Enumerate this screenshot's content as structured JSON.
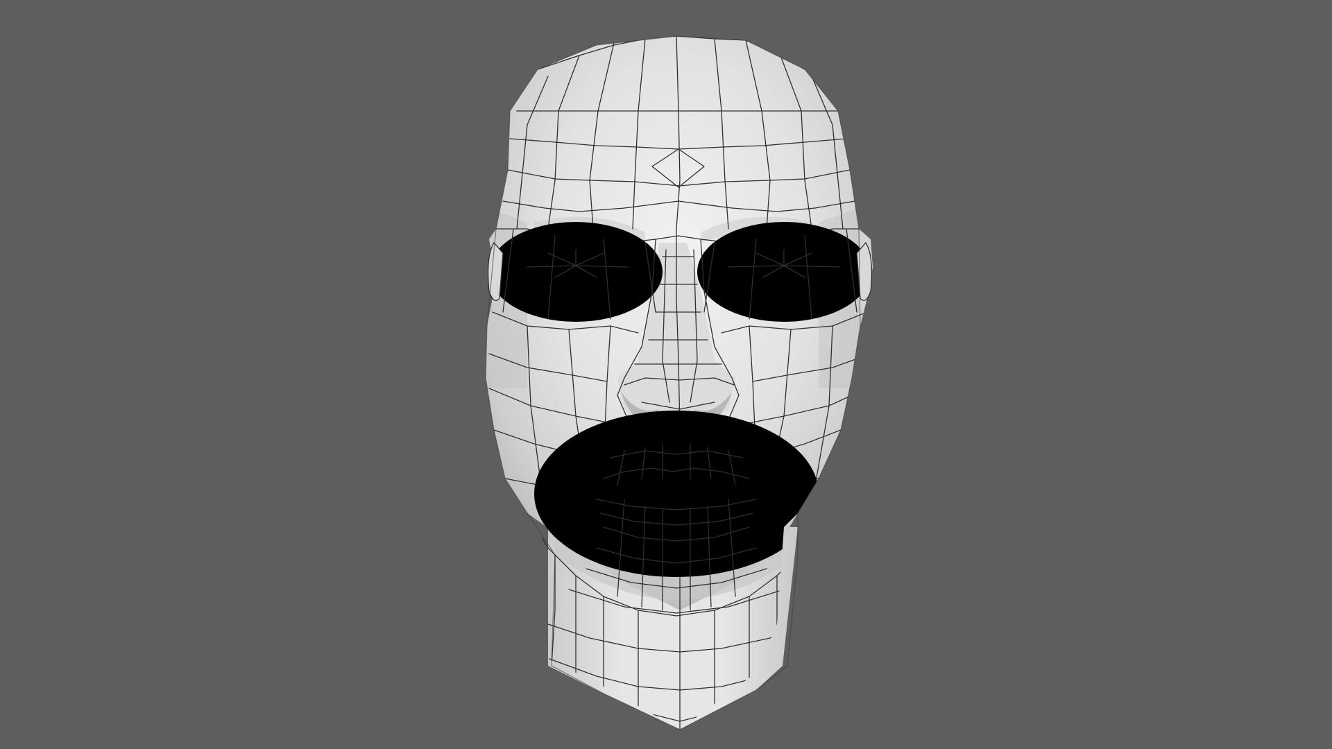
{
  "scene": {
    "background_color": "#5e5e5e",
    "model_subject": "head",
    "render_style": "wireframe-on-shaded",
    "surface_color": "#e8e8e8",
    "wire_color": "#2e2e2e"
  }
}
